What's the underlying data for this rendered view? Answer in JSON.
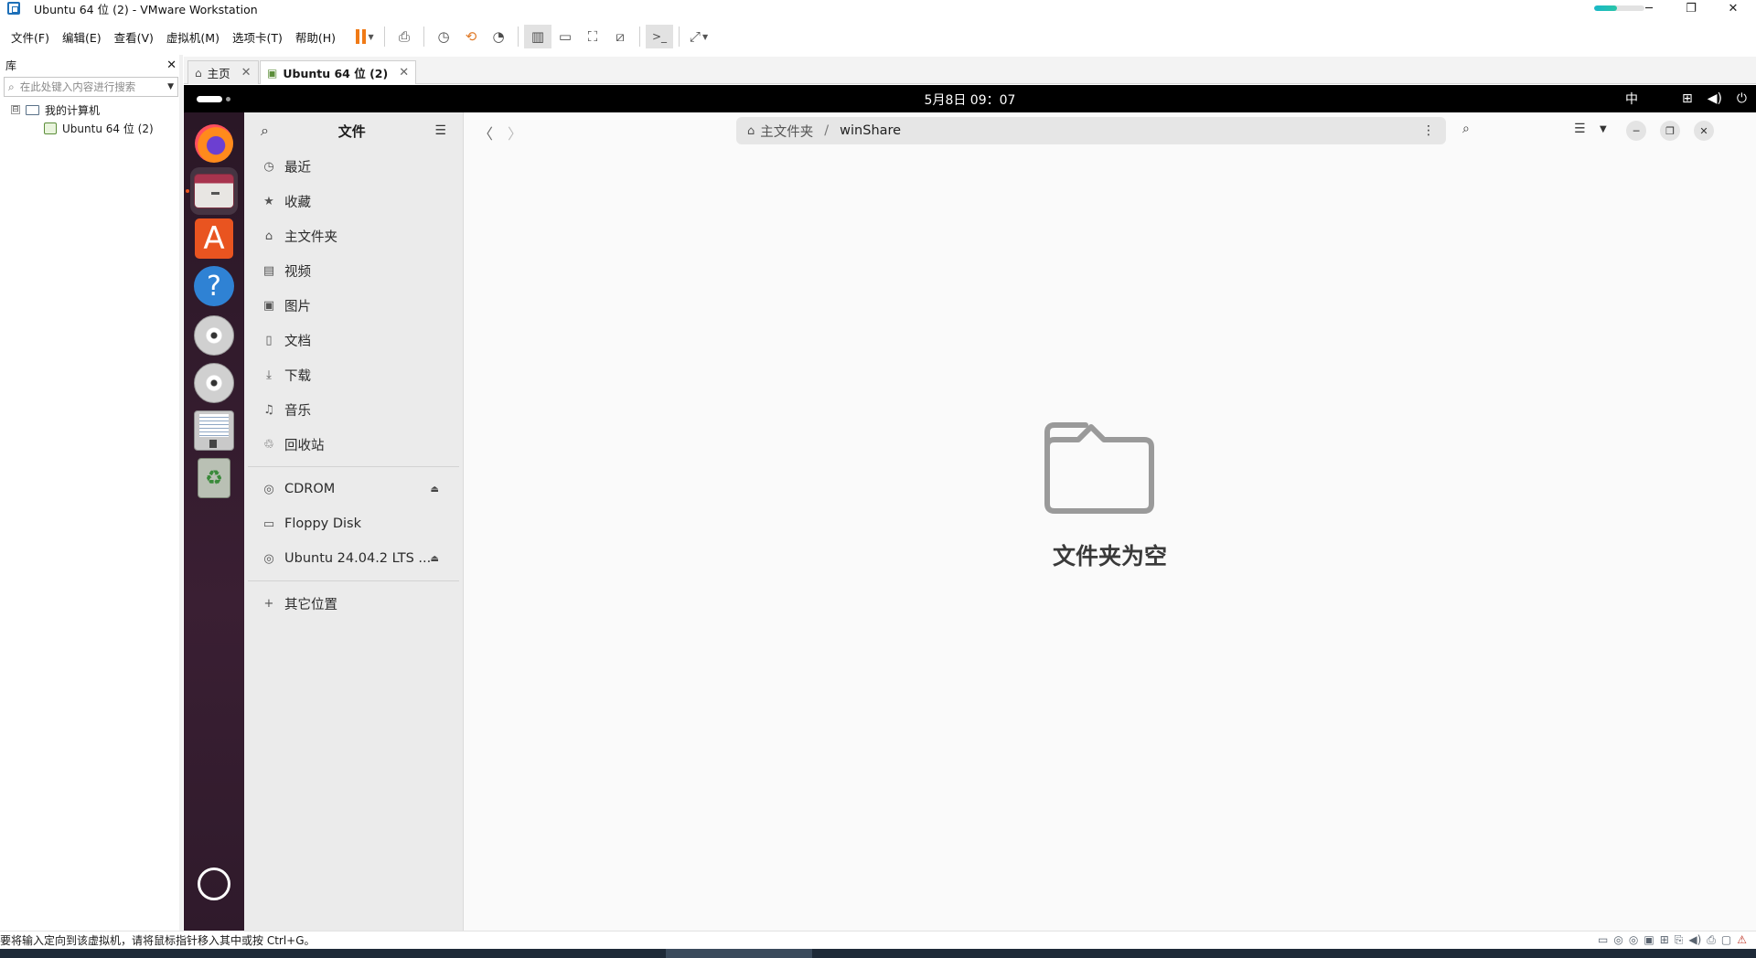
{
  "window": {
    "title": "Ubuntu 64 位 (2) - VMware Workstation",
    "progress_fraction": 0.45,
    "minimize": "─",
    "restore": "❐",
    "close": "✕"
  },
  "menubar": {
    "items": [
      "文件(F)",
      "编辑(E)",
      "查看(V)",
      "虚拟机(M)",
      "选项卡(T)",
      "帮助(H)"
    ]
  },
  "library": {
    "title": "库",
    "close": "✕",
    "search_placeholder": "在此处键入内容进行搜索",
    "tree_toggle": "⊟",
    "tree_root": "我的计算机",
    "tree_vm": "Ubuntu 64 位 (2)"
  },
  "tabs": [
    {
      "label": "主页",
      "close": "✕"
    },
    {
      "label": "Ubuntu 64 位 (2)",
      "close": "✕"
    }
  ],
  "guest": {
    "clock": "5月8日  09：07",
    "ime": "中",
    "files": {
      "title": "文件",
      "places": [
        {
          "icon": "clock-icon",
          "glyph": "◷",
          "label": "最近"
        },
        {
          "icon": "star-icon",
          "glyph": "★",
          "label": "收藏"
        },
        {
          "icon": "home-icon",
          "glyph": "⌂",
          "label": "主文件夹"
        },
        {
          "icon": "video-icon",
          "glyph": "▤",
          "label": "视频"
        },
        {
          "icon": "picture-icon",
          "glyph": "▣",
          "label": "图片"
        },
        {
          "icon": "document-icon",
          "glyph": "▯",
          "label": "文档"
        },
        {
          "icon": "download-icon",
          "glyph": "⤓",
          "label": "下载"
        },
        {
          "icon": "music-icon",
          "glyph": "♫",
          "label": "音乐"
        },
        {
          "icon": "trash-icon",
          "glyph": "♲",
          "label": "回收站"
        }
      ],
      "devices": [
        {
          "icon": "disc-icon",
          "glyph": "◎",
          "label": "CDROM",
          "eject": "⏏"
        },
        {
          "icon": "floppy-icon",
          "glyph": "▭",
          "label": "Floppy Disk",
          "eject": ""
        },
        {
          "icon": "disc-icon",
          "glyph": "◎",
          "label": "Ubuntu 24.04.2 LTS ...",
          "eject": "⏏"
        }
      ],
      "other_locations": {
        "glyph": "+",
        "label": "其它位置"
      },
      "path": {
        "home": "主文件夹",
        "separator": "/",
        "current": "winShare"
      },
      "empty_message": "文件夹为空"
    }
  },
  "statusbar": {
    "message": "要将输入定向到该虚拟机，请将鼠标指针移入其中或按 Ctrl+G。"
  }
}
